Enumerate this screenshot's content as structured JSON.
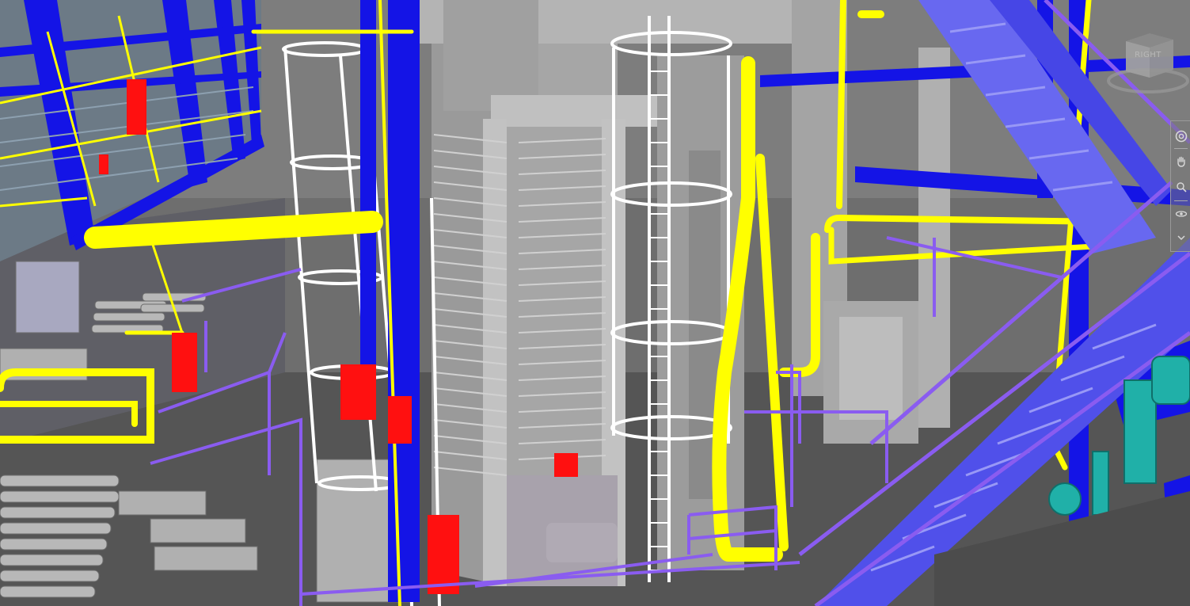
{
  "viewport": {
    "background": "#6f6f6f",
    "palette": {
      "structural_steel": "#1414e6",
      "pipe": "#ffff00",
      "valve": "#ff1010",
      "railing": "#8a5cf0",
      "stair": "#5858f0",
      "equipment": "#b4b4b4",
      "ladder": "#ffffff",
      "pump": "#20b0a8"
    }
  },
  "viewcube": {
    "face_label": "RIGHT"
  },
  "navigation_bar": {
    "tools": [
      {
        "name": "full-navigation-wheel",
        "icon": "steering-wheel-icon"
      },
      {
        "name": "pan",
        "icon": "hand-icon"
      },
      {
        "name": "zoom",
        "icon": "zoom-icon"
      },
      {
        "name": "orbit",
        "icon": "orbit-icon"
      }
    ]
  }
}
